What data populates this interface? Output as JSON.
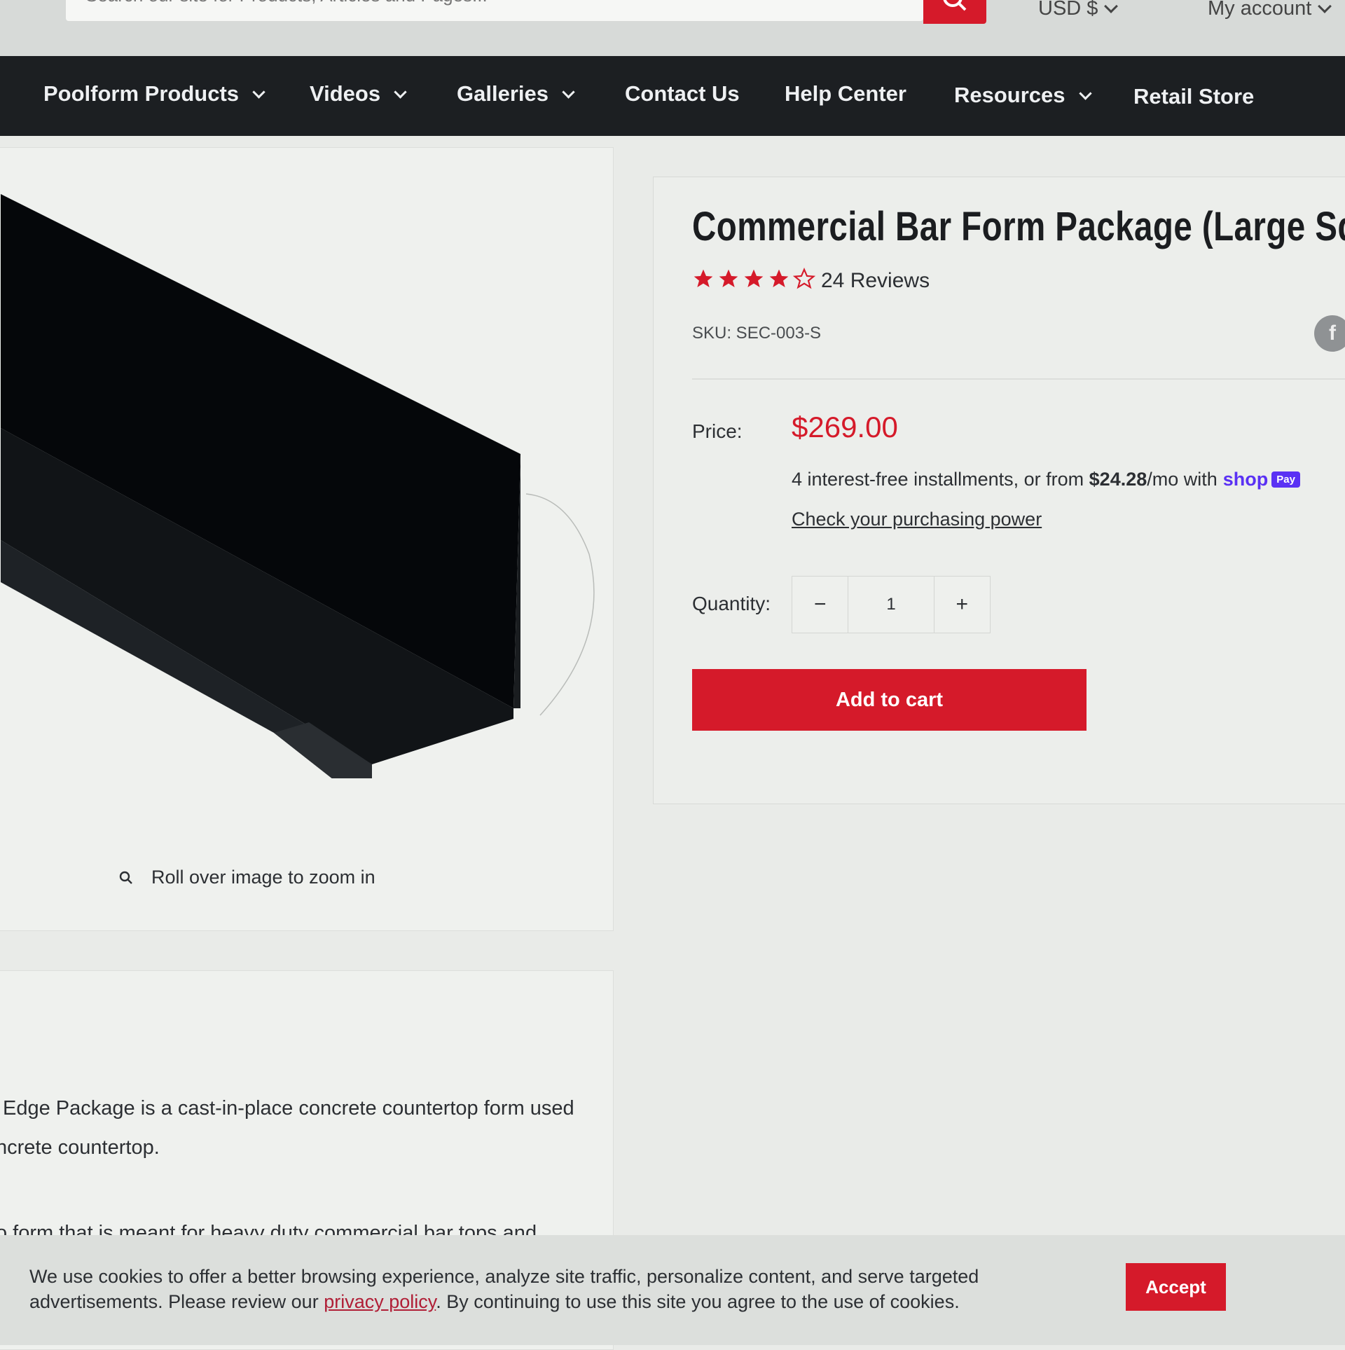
{
  "header": {
    "search_placeholder": "Search our site for Products, Articles and Pages...",
    "currency": "USD $",
    "account": "My account"
  },
  "nav": [
    {
      "label": "Poolform Products",
      "dropdown": true
    },
    {
      "label": "Videos",
      "dropdown": true
    },
    {
      "label": "Galleries",
      "dropdown": true
    },
    {
      "label": "Contact Us",
      "dropdown": false
    },
    {
      "label": "Help Center",
      "dropdown": false
    },
    {
      "label": "Resources",
      "dropdown": true
    },
    {
      "label": "Retail Store",
      "dropdown": false
    }
  ],
  "gallery": {
    "zoom_hint": "Roll over image to zoom in"
  },
  "product": {
    "title": "Commercial Bar Form Package (Large Squar",
    "rating": 4,
    "rating_max": 5,
    "reviews": "24 Reviews",
    "sku": "SKU: SEC-003-S",
    "share_icon": "f",
    "price_label": "Price:",
    "price": "$269.00",
    "installments_prefix": "4 interest-free installments, or from ",
    "installments_amount": "$24.28",
    "installments_suffix": "/mo with",
    "shop_word": "shop",
    "pay_badge": "Pay",
    "purchasing_power": "Check your purchasing power",
    "quantity_label": "Quantity:",
    "quantity": "1",
    "minus": "−",
    "plus": "+",
    "add_to_cart": "Add to cart"
  },
  "description": {
    "line1": "Edge Package is a cast-in-place concrete countertop form used",
    "line2": "ncrete countertop.",
    "line3": "o form that is meant for heavy duty commercial bar tops and"
  },
  "cookie": {
    "text_before": "We use cookies to offer a better browsing experience, analyze site traffic, personalize content, and serve targeted advertisements. Please review our ",
    "link": "privacy policy",
    "text_after": ". By continuing to use this site you agree to the use of cookies.",
    "accept": "Accept"
  },
  "colors": {
    "accent": "#d51a2a",
    "nav_bg": "#1c1f22",
    "shop_pay": "#5a31f4"
  }
}
